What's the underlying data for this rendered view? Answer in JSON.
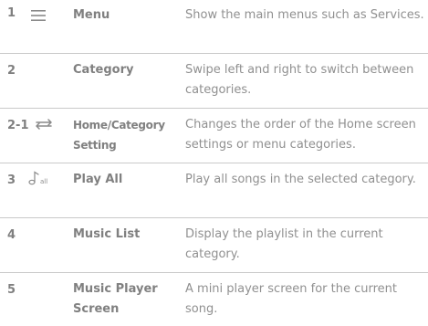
{
  "rows": [
    {
      "number": "1",
      "icon": "menu-icon",
      "name": "Menu",
      "description": "Show the main menus such as Services."
    },
    {
      "number": "2",
      "icon": "",
      "name": "Category",
      "description": "Swipe left and right to switch between categories."
    },
    {
      "number": "2-1",
      "icon": "reorder-icon",
      "name": "Home/Category Setting",
      "description": "Changes the order of the Home screen settings or menu categories."
    },
    {
      "number": "3",
      "icon": "play-all-icon",
      "name": "Play All",
      "description": "Play all songs in the selected category."
    },
    {
      "number": "4",
      "icon": "",
      "name": "Music List",
      "description": "Display the playlist in the current category."
    },
    {
      "number": "5",
      "icon": "",
      "name": "Music Player Screen",
      "description": "A mini player screen for the current song."
    }
  ],
  "colors": {
    "text": "#909090",
    "label": "#808080",
    "divider": "#c9c9c9"
  }
}
